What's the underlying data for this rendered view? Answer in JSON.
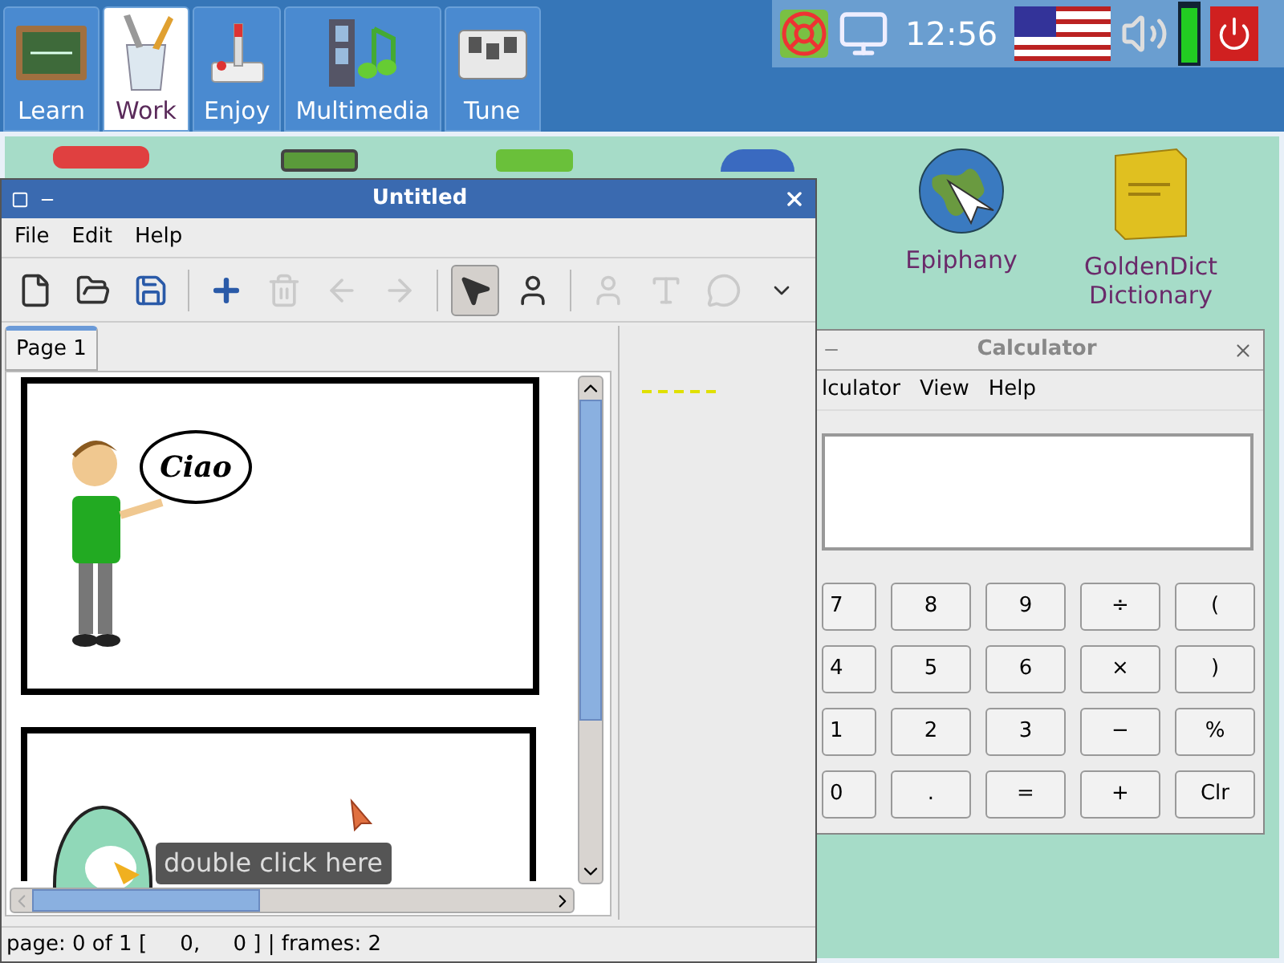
{
  "top_tabs": [
    {
      "label": "Learn",
      "kind": "chalkboard",
      "selected": false
    },
    {
      "label": "Work",
      "kind": "pencil-cup",
      "selected": true
    },
    {
      "label": "Enjoy",
      "kind": "joystick",
      "selected": false
    },
    {
      "label": "Multimedia",
      "kind": "film-note",
      "selected": false
    },
    {
      "label": "Tune",
      "kind": "mixer",
      "selected": false
    }
  ],
  "tray": {
    "clock": "12:56"
  },
  "desktop_icons": [
    {
      "label": "Epiphany",
      "kind": "globe"
    },
    {
      "label": "GoldenDict Dictionary",
      "kind": "book"
    }
  ],
  "calculator": {
    "title": "Calculator",
    "menu": [
      "lculator",
      "View",
      "Help"
    ],
    "keys": [
      "7",
      "8",
      "9",
      "÷",
      "(",
      "4",
      "5",
      "6",
      "×",
      ")",
      "1",
      "2",
      "3",
      "−",
      "%",
      "0",
      ".",
      "=",
      "+",
      "Clr"
    ]
  },
  "editor": {
    "title": "Untitled",
    "menu": [
      "File",
      "Edit",
      "Help"
    ],
    "toolbar_groups": [
      [
        {
          "kind": "new",
          "disabled": false,
          "selected": false
        },
        {
          "kind": "open",
          "disabled": false,
          "selected": false
        },
        {
          "kind": "save",
          "disabled": false,
          "selected": false
        }
      ],
      [
        {
          "kind": "add",
          "disabled": false,
          "selected": false
        },
        {
          "kind": "delete",
          "disabled": true,
          "selected": false
        },
        {
          "kind": "back",
          "disabled": true,
          "selected": false
        },
        {
          "kind": "forward",
          "disabled": true,
          "selected": false
        }
      ],
      [
        {
          "kind": "pointer",
          "disabled": false,
          "selected": true
        },
        {
          "kind": "character",
          "disabled": false,
          "selected": false
        }
      ],
      [
        {
          "kind": "figure",
          "disabled": true,
          "selected": false
        },
        {
          "kind": "text",
          "disabled": true,
          "selected": false
        },
        {
          "kind": "bubble",
          "disabled": true,
          "selected": false
        },
        {
          "kind": "more",
          "disabled": false,
          "selected": false
        }
      ]
    ],
    "page_tabs": [
      {
        "label": "Page 1",
        "selected": true
      }
    ],
    "speech": "Ciao",
    "tooltip": "double click here",
    "status": "page: 0 of 1 [     0,     0 ] | frames: 2"
  }
}
